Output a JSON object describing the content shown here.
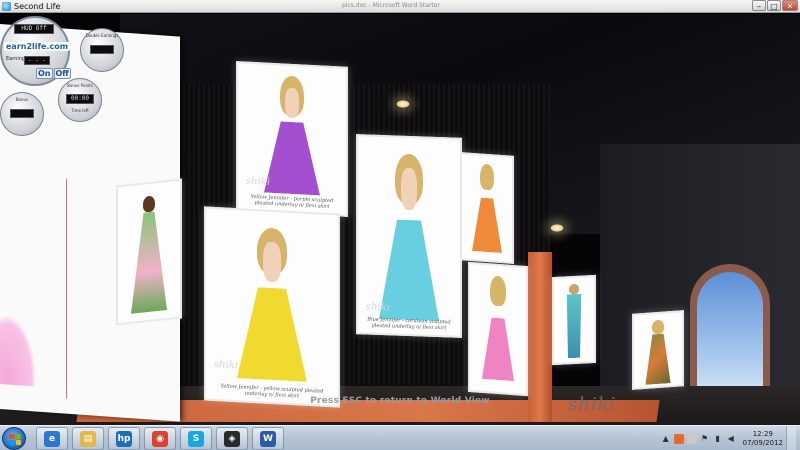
{
  "window": {
    "title": "Second Life",
    "background_title": "pics.doc - Microsoft Word Starter",
    "minimize_glyph": "–",
    "maximize_glyph": "□",
    "close_glyph": "✕"
  },
  "hud": {
    "brand": "earn2life.com",
    "status_screen": "HUD Off",
    "earnings_label": "Earnings",
    "earnings_value": "- - -",
    "on_label": "On",
    "off_label": "Off",
    "timer_value": "00:00",
    "time_left_label": "Time left",
    "dial1_label": "Double Earnings",
    "dial2_label": "Bonus",
    "dial3_label": "Bonus Points"
  },
  "viewport": {
    "esc_message": "Press ESC to return to World View",
    "floor_brand": "shiki"
  },
  "posters": [
    {
      "brand": "shiki",
      "caption": "Yellow Jennifer - purple\nsculpted pleated underlay n/ flexi skirt",
      "skirt_color": "#a44fd0"
    },
    {
      "brand": "shiki",
      "caption": "Yellow Jennifer - yellow\nsculpted pleated underlay n/ flexi skirt",
      "skirt_color": "#f1da2f"
    },
    {
      "brand": "shiki",
      "caption": "Blue Jennifer - cerulean\nsculpted pleated underlay n/ flexi skirt",
      "skirt_color": "#67cfe0"
    },
    {
      "brand": "shiki",
      "caption": "",
      "skirt_color": "#f08a3a"
    },
    {
      "brand": "shiki",
      "caption": "",
      "skirt_color": "#ef84c3"
    }
  ],
  "taskbar": {
    "time": "12:29",
    "date": "07/09/2012",
    "items": [
      {
        "name": "internet-explorer",
        "glyph": "e",
        "color": "#2a78d2"
      },
      {
        "name": "file-explorer",
        "glyph": "▤",
        "color": "#e2b94a"
      },
      {
        "name": "hp-app",
        "glyph": "hp",
        "color": "#1b6fb8"
      },
      {
        "name": "chrome",
        "glyph": "◉",
        "color": "#d9432f"
      },
      {
        "name": "skype",
        "glyph": "S",
        "color": "#19a7e3"
      },
      {
        "name": "second-life",
        "glyph": "◈",
        "color": "#2a2a2a"
      },
      {
        "name": "word",
        "glyph": "W",
        "color": "#2a5aa8"
      }
    ]
  }
}
